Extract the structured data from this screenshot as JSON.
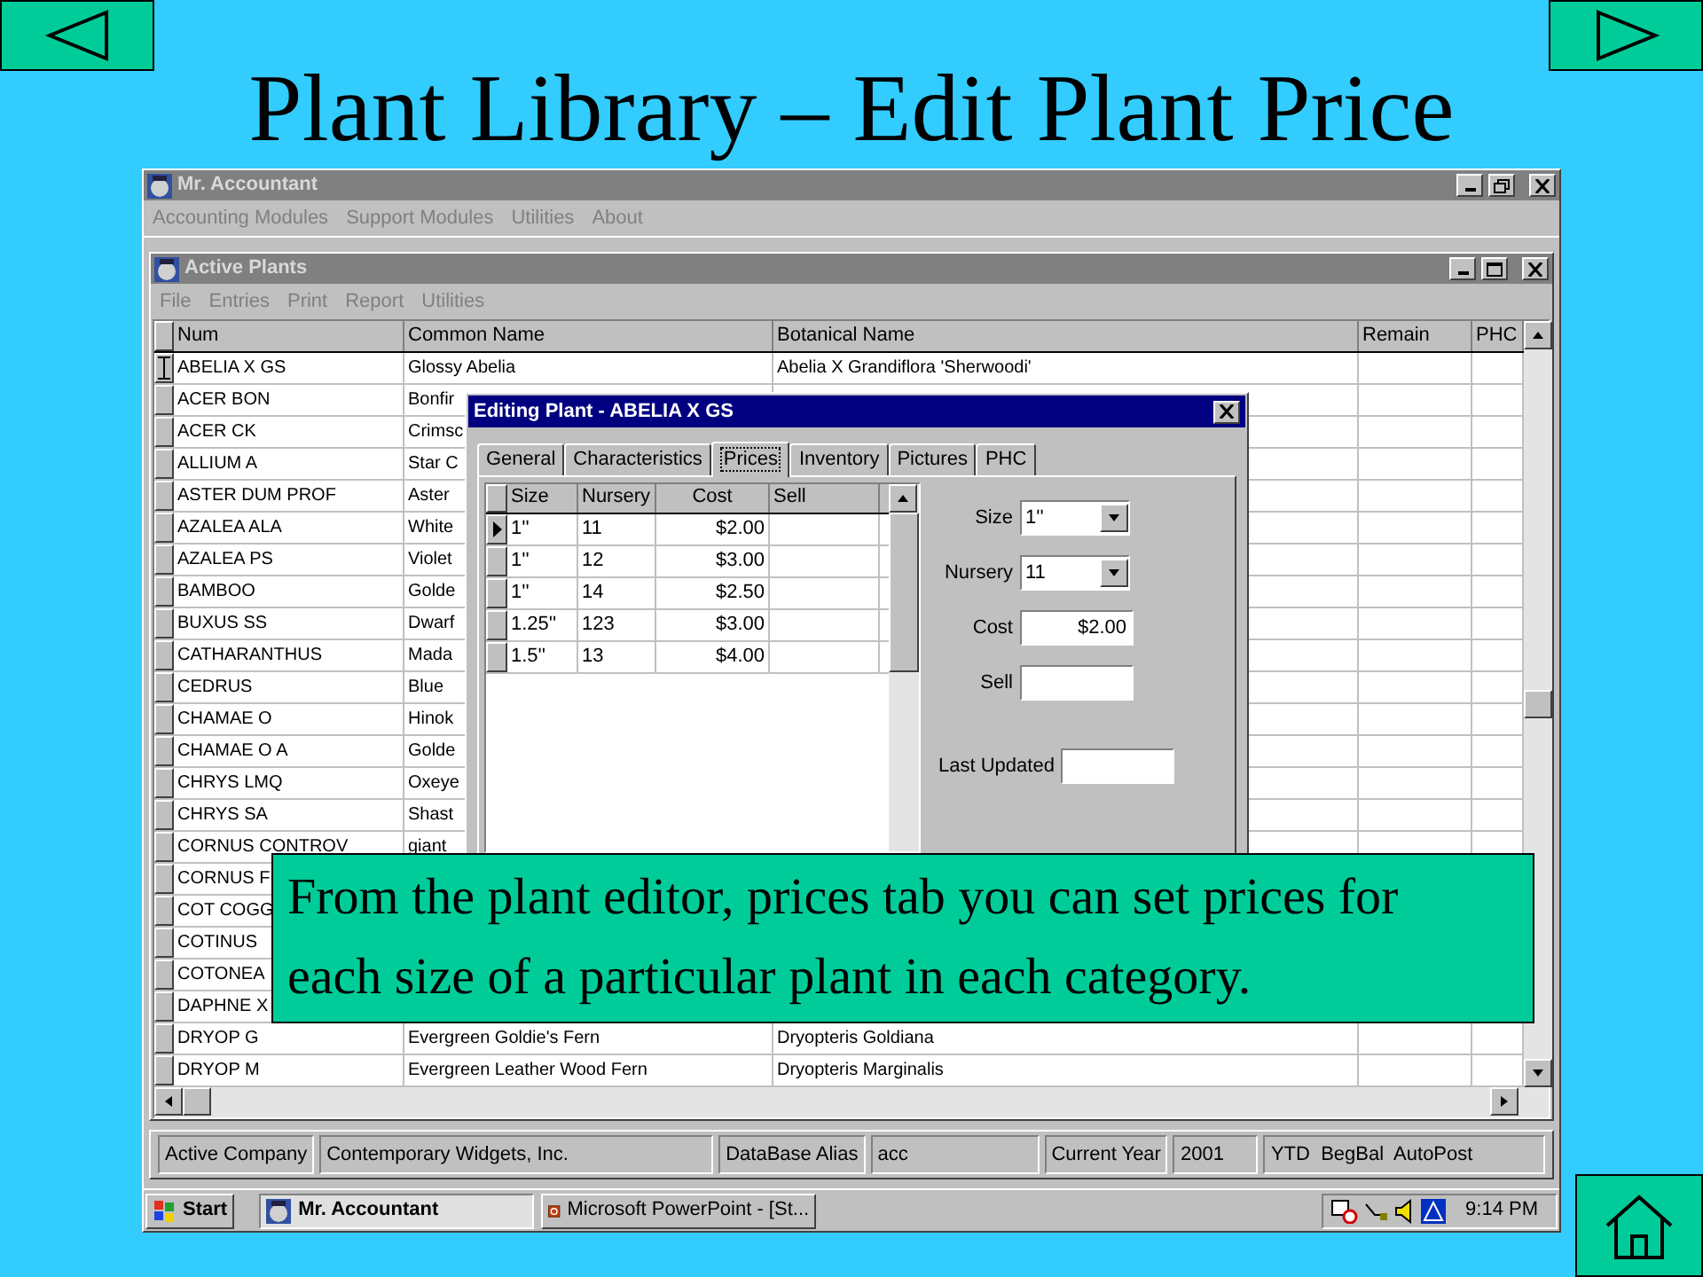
{
  "slide": {
    "title": "Plant Library – Edit Plant Price",
    "callout": "From the plant editor, prices tab you can set prices for each size of a particular plant in each category."
  },
  "app_window": {
    "title": "Mr. Accountant",
    "menu": [
      {
        "label": "Accounting Modules",
        "disabled": true
      },
      {
        "label": "Support Modules",
        "disabled": true
      },
      {
        "label": "Utilities",
        "disabled": true
      },
      {
        "label": "About",
        "disabled": true
      }
    ]
  },
  "child_window": {
    "title": "Active Plants",
    "menu": [
      {
        "label": "File",
        "disabled": true
      },
      {
        "label": "Entries",
        "disabled": true
      },
      {
        "label": "Print",
        "disabled": true
      },
      {
        "label": "Report",
        "disabled": true
      },
      {
        "label": "Utilities",
        "disabled": true
      }
    ],
    "table": {
      "columns": [
        "Num",
        "Common Name",
        "Botanical Name",
        "Remain",
        "PHC"
      ],
      "rows": [
        {
          "num": "ABELIA X GS",
          "common_name": "Glossy Abelia",
          "botanical_name": "Abelia X Grandiflora 'Sherwoodi'"
        },
        {
          "num": "ACER BON",
          "common_name": "Bonfir"
        },
        {
          "num": "ACER CK",
          "common_name": "Crimsc"
        },
        {
          "num": "ALLIUM A",
          "common_name": "Star C"
        },
        {
          "num": "ASTER DUM PROF",
          "common_name": "Aster"
        },
        {
          "num": "AZALEA ALA",
          "common_name": "White"
        },
        {
          "num": "AZALEA PS",
          "common_name": "Violet"
        },
        {
          "num": "BAMBOO",
          "common_name": "Golde"
        },
        {
          "num": "BUXUS SS",
          "common_name": "Dwarf"
        },
        {
          "num": "CATHARANTHUS",
          "common_name": "Mada"
        },
        {
          "num": "CEDRUS",
          "common_name": "Blue"
        },
        {
          "num": "CHAMAE O",
          "common_name": "Hinok"
        },
        {
          "num": "CHAMAE O A",
          "common_name": "Golde"
        },
        {
          "num": "CHRYS LMQ",
          "common_name": "Oxeye"
        },
        {
          "num": "CHRYS SA",
          "common_name": "Shast"
        },
        {
          "num": "CORNUS CONTROV",
          "common_name": "giant"
        },
        {
          "num": "CORNUS F"
        },
        {
          "num": "COT COGG"
        },
        {
          "num": "COTINUS"
        },
        {
          "num": "COTONEA"
        },
        {
          "num": "DAPHNE X"
        },
        {
          "num": "DRYOP G",
          "common_name": "Evergreen Goldie's Fern",
          "botanical_name": "Dryopteris Goldiana"
        },
        {
          "num": "DRYOP M",
          "common_name": "Evergreen Leather Wood Fern",
          "botanical_name": "Dryopteris Marginalis"
        }
      ]
    }
  },
  "dialog": {
    "title": "Editing Plant - ABELIA X GS",
    "tabs": [
      {
        "label": "General",
        "selected": false
      },
      {
        "label": "Characteristics",
        "selected": false
      },
      {
        "label": "Prices",
        "selected": true
      },
      {
        "label": "Inventory",
        "selected": false
      },
      {
        "label": "Pictures",
        "selected": false
      },
      {
        "label": "PHC",
        "selected": false
      }
    ],
    "price_table": {
      "columns": [
        "Size",
        "Nursery",
        "Cost",
        "Sell"
      ],
      "rows": [
        {
          "size": "1''",
          "nursery": "11",
          "cost": "$2.00",
          "current": true
        },
        {
          "size": "1''",
          "nursery": "12",
          "cost": "$3.00",
          "current": false
        },
        {
          "size": "1''",
          "nursery": "14",
          "cost": "$2.50",
          "current": false
        },
        {
          "size": "1.25''",
          "nursery": "123",
          "cost": "$3.00",
          "current": false
        },
        {
          "size": "1.5''",
          "nursery": "13",
          "cost": "$4.00",
          "current": false
        }
      ]
    },
    "fields": [
      {
        "label": "Size",
        "kind": "combo",
        "value": "1''"
      },
      {
        "label": "Nursery",
        "kind": "combo",
        "value": "11"
      },
      {
        "label": "Cost",
        "kind": "text",
        "value": "$2.00"
      },
      {
        "label": "Sell",
        "kind": "text"
      },
      {
        "label": "Last Updated",
        "kind": "text"
      }
    ]
  },
  "status_bar": [
    {
      "label": "Active Company",
      "value": "Contemporary Widgets, Inc."
    },
    {
      "label": "DataBase Alias",
      "value": "acc"
    },
    {
      "label": "Current Year",
      "value": "2001"
    },
    {
      "label": "YTD  BegBal  AutoPost"
    }
  ],
  "taskbar": {
    "start": "Start",
    "tasks": [
      {
        "label": "Mr. Accountant",
        "selected": true
      },
      {
        "label": "Microsoft PowerPoint - [St...",
        "selected": false
      }
    ],
    "clock": "9:14 PM"
  }
}
